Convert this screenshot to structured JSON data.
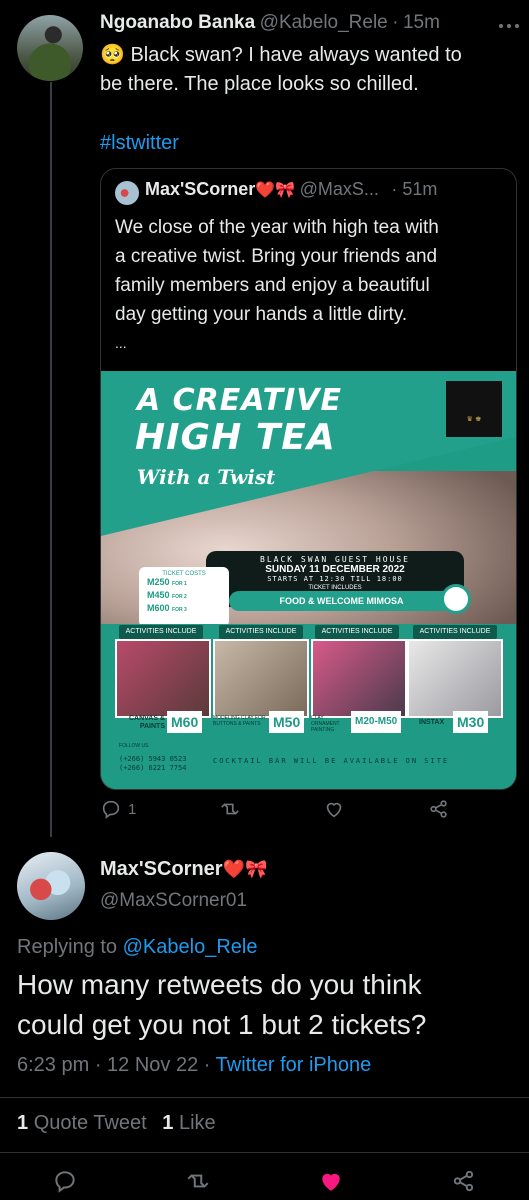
{
  "tweet1": {
    "author_name": "Ngoanabo Banka",
    "handle": "@Kabelo_Rele",
    "time": "15m",
    "emoji": "🥺",
    "text_line1": "Black swan? I have always wanted to",
    "text_line2": "be there. The place looks so chilled.",
    "hashtag": "#lstwitter"
  },
  "quoted": {
    "author_name": "Max'SCorner",
    "author_emoji": "❤️🎀",
    "handle": "@MaxS...",
    "time": "· 51m",
    "lines": [
      "We close of the year with high tea with",
      "a creative twist. Bring your friends and",
      "family members and enjoy a beautiful",
      "day getting your hands a little dirty.",
      "..."
    ],
    "poster": {
      "title1": "A CREATIVE",
      "title2": "HIGH TEA",
      "subtitle": "With a Twist",
      "venue": "BLACK SWAN GUEST HOUSE",
      "date": "SUNDAY 11 DECEMBER 2022",
      "time": "STARTS AT 12:30 TILL 18:00",
      "includes_label": "TICKET INCLUDES",
      "includes": "FOOD & WELCOME MIMOSA",
      "ticket_label": "TICKET COSTS",
      "prices": [
        "M250",
        "M450",
        "M600"
      ],
      "price_notes": [
        "FOR 1",
        "FOR 2",
        "FOR 3"
      ],
      "act_head": "ACTIVITIES INCLUDE",
      "activities": [
        {
          "label": "CANVAS & PAINTS",
          "price": "M60"
        },
        {
          "label": "MODELING CLAY FOR BUTTONS & PAINTS",
          "price": "M50"
        },
        {
          "label": "CLAY ORNAMENT PAINTING",
          "price": "M20-M50"
        },
        {
          "label": "INSTAX",
          "price": "M30"
        }
      ],
      "follow": "FOLLOW US",
      "phone1": "(+266) 5943 0523",
      "phone2": "(+266) 6221 7754",
      "footer": "COCKTAIL BAR WILL BE AVAILABLE ON SITE"
    }
  },
  "tweet1_actions": {
    "reply_count": "1"
  },
  "reply": {
    "author_name": "Max'SCorner",
    "author_emoji": "❤️🎀",
    "handle": "@MaxSCorner01",
    "replying_prefix": "Replying to",
    "replying_handle": "@Kabelo_Rele",
    "text_line1": "How many retweets do you think",
    "text_line2": "could get you not 1 but 2 tickets?",
    "time": "6:23 pm · 12 Nov 22 ·",
    "client": "Twitter for iPhone",
    "quote_count": "1",
    "quote_label": "Quote Tweet",
    "like_count": "1",
    "like_label": "Like"
  },
  "colors": {
    "accent": "#1d9bf0",
    "like": "#f91880",
    "poster_teal": "#1f9c86"
  }
}
